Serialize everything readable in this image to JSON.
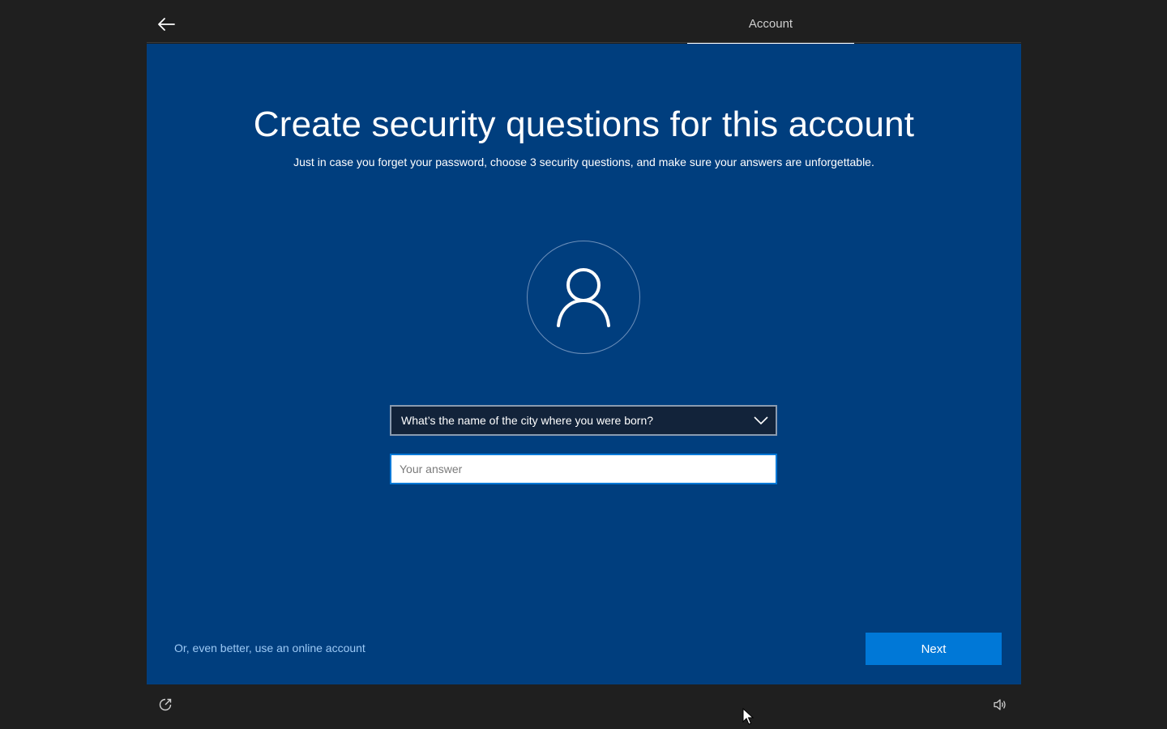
{
  "header": {
    "back_icon": "back-arrow-icon",
    "active_tab": "Account"
  },
  "main": {
    "title": "Create security questions for this account",
    "subtitle": "Just in case you forget your password, choose 3 security questions, and make sure your answers are unforgettable.",
    "avatar_icon": "user-icon",
    "security_question": {
      "selected": "What’s the name of the city where you were born?",
      "icon": "chevron-down-icon"
    },
    "answer": {
      "value": "",
      "placeholder": "Your answer"
    },
    "online_account_link": "Or, even better, use an online account",
    "next_label": "Next"
  },
  "footer": {
    "left_icon": "ease-of-access-icon",
    "right_icon": "volume-icon"
  },
  "colors": {
    "panel_background": "#003e7e",
    "accent": "#0078d7",
    "screen_background": "#1f1f1f",
    "link": "#9cc9f5"
  }
}
